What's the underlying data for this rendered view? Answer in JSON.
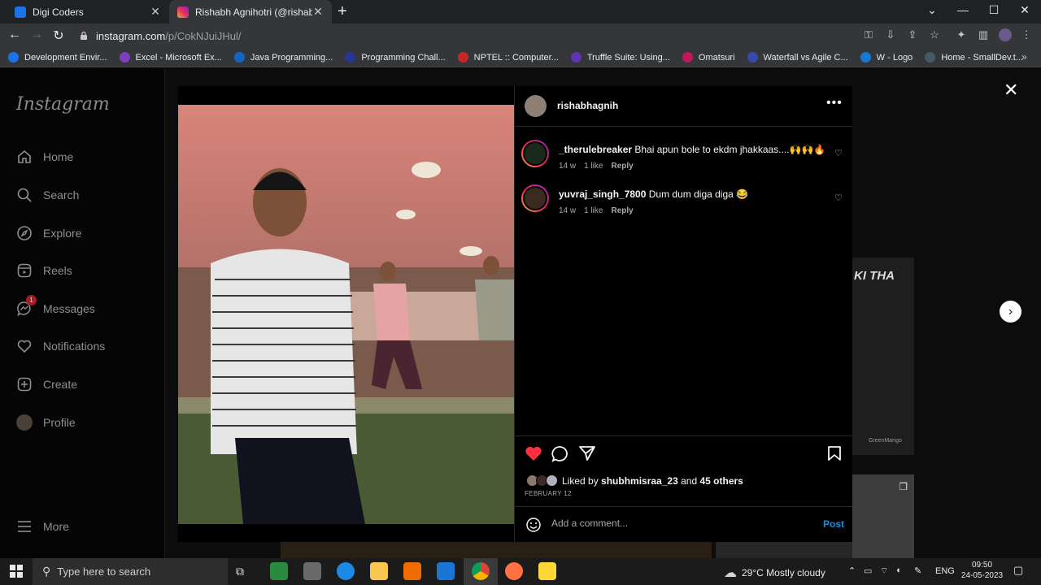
{
  "browser": {
    "tabs": [
      {
        "title": "Digi Coders",
        "color": "#1a73e8"
      },
      {
        "title": "Rishabh Agnihotri (@rishabhagnih",
        "color": "#e1306c"
      }
    ],
    "url_domain": "instagram.com",
    "url_path": "/p/CokNJuiJHul/",
    "bookmarks": [
      {
        "label": "Development Envir...",
        "color": "#1a73e8"
      },
      {
        "label": "Excel - Microsoft Ex...",
        "color": "#7b3fbf"
      },
      {
        "label": "Java Programming...",
        "color": "#1565c0"
      },
      {
        "label": "Programming Chall...",
        "color": "#283593"
      },
      {
        "label": "NPTEL :: Computer...",
        "color": "#c62828"
      },
      {
        "label": "Truffle Suite: Using...",
        "color": "#5e35b1"
      },
      {
        "label": "Omatsuri",
        "color": "#c2185b"
      },
      {
        "label": "Waterfall vs Agile C...",
        "color": "#3949ab"
      },
      {
        "label": "W - Logo",
        "color": "#1976d2"
      },
      {
        "label": "Home - SmallDev.t...",
        "color": "#455a64"
      }
    ]
  },
  "sidebar": {
    "logo": "Instagram",
    "items": [
      {
        "label": "Home",
        "icon": "home-icon"
      },
      {
        "label": "Search",
        "icon": "search-icon"
      },
      {
        "label": "Explore",
        "icon": "compass-icon"
      },
      {
        "label": "Reels",
        "icon": "reels-icon"
      },
      {
        "label": "Messages",
        "icon": "messenger-icon",
        "badge": "1"
      },
      {
        "label": "Notifications",
        "icon": "heart-icon"
      },
      {
        "label": "Create",
        "icon": "plus-square-icon"
      },
      {
        "label": "Profile",
        "icon": "avatar"
      }
    ],
    "more": "More"
  },
  "background": {
    "tile_text": "KI THA",
    "tile_caption": "GreenMango"
  },
  "post": {
    "owner": "rishabhagnih",
    "comments": [
      {
        "user": "_therulebreaker",
        "text": "Bhai apun bole to ekdm jhakkaas....🙌🙌🔥",
        "time": "14 w",
        "likes": "1 like",
        "reply": "Reply"
      },
      {
        "user": "yuvraj_singh_7800",
        "text": "Dum dum diga diga 😂",
        "time": "14 w",
        "likes": "1 like",
        "reply": "Reply"
      }
    ],
    "liked_prefix": "Liked by",
    "liked_user": "shubhmisraa_23",
    "liked_and": "and",
    "liked_others": "45 others",
    "date": "FEBRUARY 12",
    "comment_placeholder": "Add a comment...",
    "post_label": "Post"
  },
  "taskbar": {
    "search_placeholder": "Type here to search",
    "weather": "29°C  Mostly cloudy",
    "lang": "ENG",
    "time": "09:50",
    "date": "24-05-2023"
  },
  "colors": {
    "like_red": "#ff3040",
    "link_blue": "#0095f6"
  }
}
